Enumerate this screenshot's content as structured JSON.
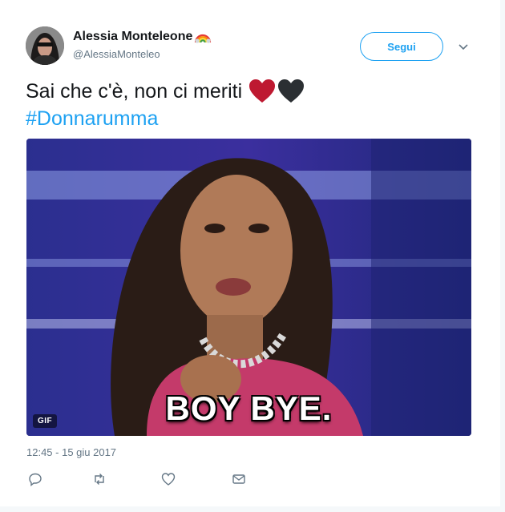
{
  "tweet": {
    "author_name": "Alessia Monteleone",
    "author_handle": "@AlessiaMonteleo",
    "follow_label": "Segui",
    "text": "Sai che c'è, non ci meriti",
    "hashtag": "#Donnarumma",
    "timestamp": "12:45 - 15 giu 2017",
    "media": {
      "badge": "GIF",
      "caption": "BOY BYE."
    },
    "icons": {
      "rainbow": "rainbow-emoji",
      "hearts": [
        "red-heart-emoji",
        "black-heart-emoji"
      ],
      "actions": [
        "reply-icon",
        "retweet-icon",
        "like-icon",
        "direct-message-icon"
      ]
    }
  },
  "colors": {
    "accent": "#1da1f2",
    "text": "#14171a",
    "muted": "#657786"
  }
}
